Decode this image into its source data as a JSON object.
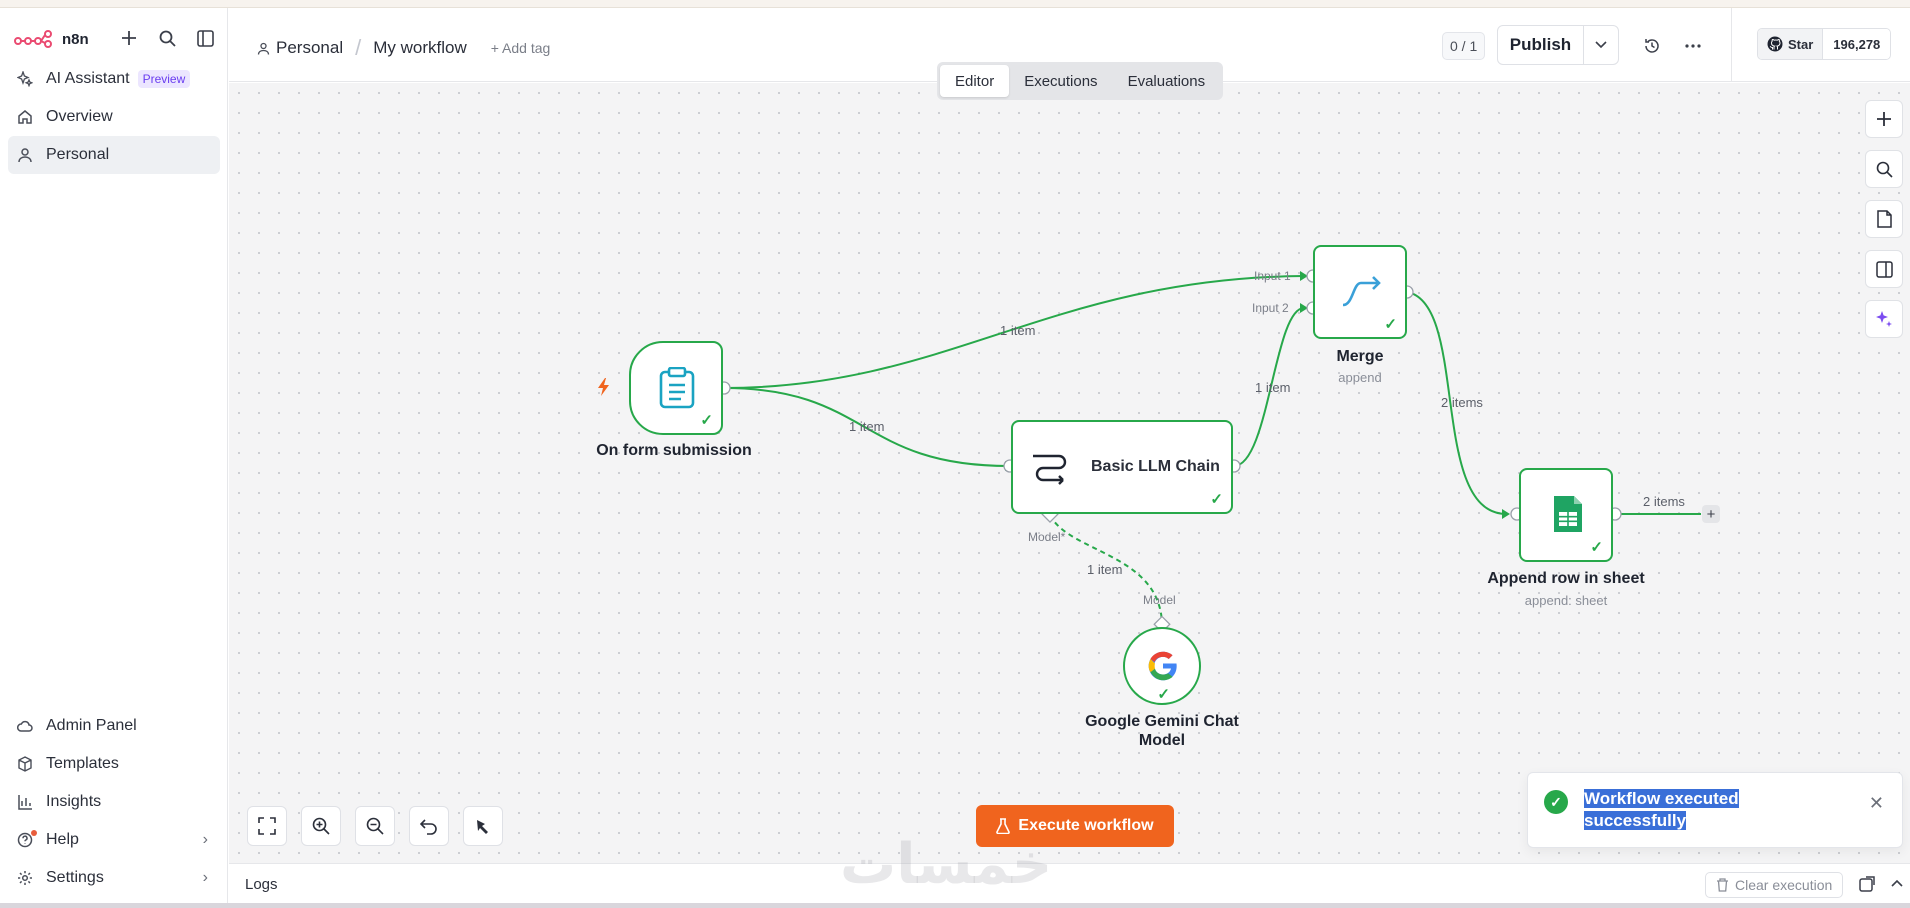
{
  "app": {
    "logo": "n8n"
  },
  "sidebar": {
    "top_items": [
      {
        "label": "AI Assistant",
        "badge": "Preview",
        "icon": "sparkles-icon"
      },
      {
        "label": "Overview",
        "icon": "home-icon"
      },
      {
        "label": "Personal",
        "icon": "user-icon",
        "active": true
      }
    ],
    "bottom_items": [
      {
        "label": "Admin Panel",
        "icon": "cloud-icon"
      },
      {
        "label": "Templates",
        "icon": "box-icon"
      },
      {
        "label": "Insights",
        "icon": "bar-chart-icon"
      },
      {
        "label": "Help",
        "icon": "help-icon"
      },
      {
        "label": "Settings",
        "icon": "gear-icon"
      }
    ]
  },
  "header": {
    "breadcrumb_project": "Personal",
    "workflow_name": "My workflow",
    "add_tag": "+ Add tag",
    "counter": "0 / 1",
    "publish": "Publish",
    "github_star": "Star",
    "github_count": "196,278"
  },
  "tabs": [
    "Editor",
    "Executions",
    "Evaluations"
  ],
  "active_tab": "Editor",
  "nodes": {
    "form": {
      "title": "On form submission"
    },
    "llm": {
      "title": "Basic LLM Chain",
      "port_label": "Model*"
    },
    "merge": {
      "title": "Merge",
      "subtitle": "append",
      "input1": "Input 1",
      "input2": "Input 2"
    },
    "sheet": {
      "title": "Append row in sheet",
      "subtitle": "append: sheet"
    },
    "gemini": {
      "title_line1": "Google Gemini Chat",
      "title_line2": "Model",
      "port_label": "Model"
    }
  },
  "edge_labels": {
    "form_to_merge": "1 item",
    "form_to_llm": "1 item",
    "llm_to_merge": "1 item",
    "merge_to_sheet": "2 items",
    "sheet_out": "2 items",
    "gemini_to_llm": "1 item"
  },
  "execute_button": "Execute workflow",
  "toast": {
    "line1": "Workflow executed",
    "line2": "successfully"
  },
  "logs": {
    "label": "Logs",
    "clear": "Clear execution"
  },
  "watermark": "خمسات",
  "colors": {
    "accent": "#f0641e",
    "success": "#27a84a",
    "edge": "#27a84a",
    "selection": "#3a6fd8"
  }
}
